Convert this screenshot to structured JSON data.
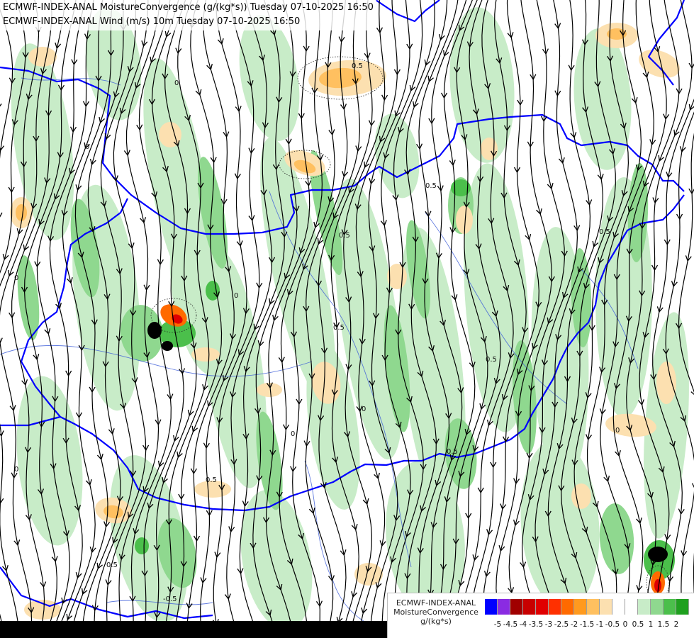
{
  "titles": {
    "line1": "ECMWF-INDEX-ANAL MoistureConvergence (g/(kg*s)) Tuesday 07-10-2025 16:50",
    "line2": "ECMWF-INDEX-ANAL Wind (m/s) 10m Tuesday 07-10-2025 16:50"
  },
  "legend": {
    "title_line1": "ECMWF-INDEX-ANAL",
    "title_line2": "MoistureConvergence",
    "units": "g/(kg*s)",
    "colors": [
      "#0000ff",
      "#8a2be2",
      "#a00000",
      "#c80000",
      "#e00000",
      "#ff3000",
      "#ff6a00",
      "#ff9a1e",
      "#ffc060",
      "#fce0b0",
      "#ffffff",
      "#ffffff",
      "#c8ecc8",
      "#8fd88f",
      "#4bbf4b",
      "#1fa01f"
    ],
    "tick_labels": [
      "-5",
      "-4.5",
      "-4",
      "-3.5",
      "-3",
      "-2.5",
      "-2",
      "-1.5",
      "-1",
      "-0.5",
      "0",
      "0.5",
      "1",
      "1.5",
      "2"
    ]
  },
  "map": {
    "wind_direction": "north-to-south",
    "contour_labels": [
      "0.5",
      "0",
      "-0.5"
    ],
    "colors": {
      "background": "#ffffff",
      "convergence_light": "#c8ecc8",
      "convergence_mid": "#8fd88f",
      "convergence_strong": "#4bbf4b",
      "divergence_light": "#fce0b0",
      "divergence_mid": "#ffc060",
      "divergence_strong": "#ff6a00",
      "divergence_extreme": "#e00000",
      "streamline": "#000000",
      "country_border": "#0000ff",
      "river": "#3c5cd8"
    }
  }
}
